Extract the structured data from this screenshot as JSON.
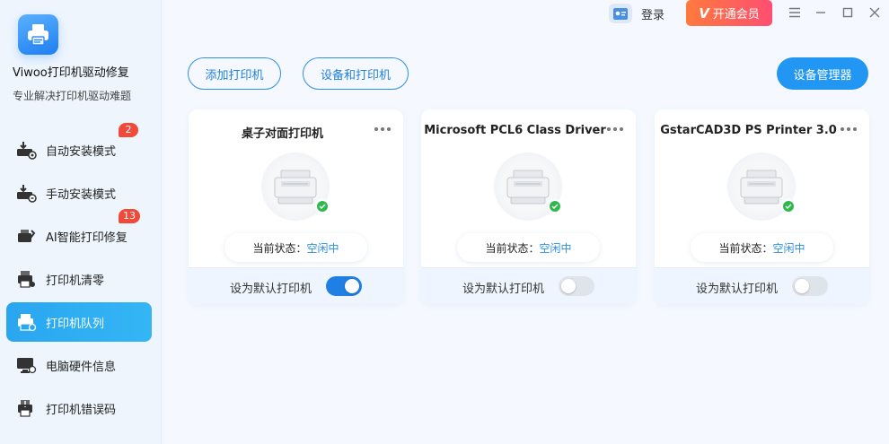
{
  "app": {
    "name": "Viwoo打印机驱动修复",
    "subtitle": "专业解决打印机驱动难题"
  },
  "header": {
    "login_label": "登录",
    "vip_label": "开通会员",
    "vip_mark": "V"
  },
  "sidebar": {
    "items": [
      {
        "label": "自动安装模式",
        "icon": "auto-install-icon",
        "badge": "2"
      },
      {
        "label": "手动安装模式",
        "icon": "manual-install-icon",
        "badge": ""
      },
      {
        "label": "AI智能打印修复",
        "icon": "ai-repair-icon",
        "badge": "13"
      },
      {
        "label": "打印机清零",
        "icon": "printer-reset-icon",
        "badge": ""
      },
      {
        "label": "打印机队列",
        "icon": "printer-queue-icon",
        "badge": "",
        "active": true
      },
      {
        "label": "电脑硬件信息",
        "icon": "hardware-info-icon",
        "badge": ""
      },
      {
        "label": "打印机错误码",
        "icon": "error-code-icon",
        "badge": ""
      }
    ]
  },
  "toolbar": {
    "add_printer": "添加打印机",
    "devices_printers": "设备和打印机",
    "device_manager": "设备管理器"
  },
  "printers": [
    {
      "name": "桌子对面打印机",
      "status_label": "当前状态：",
      "status_value": "空闲中",
      "default_label": "设为默认打印机",
      "is_default": true
    },
    {
      "name": "Microsoft PCL6 Class Driver",
      "status_label": "当前状态：",
      "status_value": "空闲中",
      "default_label": "设为默认打印机",
      "is_default": false
    },
    {
      "name": "GstarCAD3D PS Printer 3.0",
      "status_label": "当前状态：",
      "status_value": "空闲中",
      "default_label": "设为默认打印机",
      "is_default": false
    }
  ],
  "colors": {
    "accent": "#2196f3",
    "active_nav": "#2aa6f0",
    "badge": "#f24a3a",
    "status_ok": "#2fb94d",
    "vip_start": "#ff7a3d",
    "vip_end": "#ff4e72"
  }
}
